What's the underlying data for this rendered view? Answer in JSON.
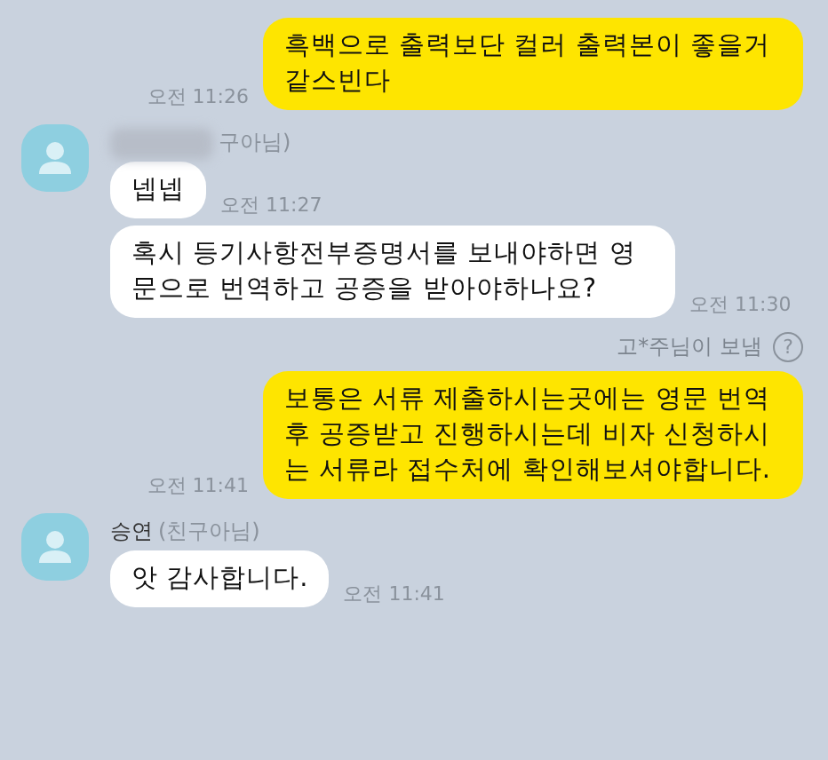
{
  "messages": [
    {
      "kind": "sent",
      "text": "흑백으로 출력보단 컬러 출력본이 좋을거 같스빈다",
      "time": "오전 11:26"
    },
    {
      "kind": "received",
      "sender": {
        "name_redacted": true,
        "note": "구아님)"
      },
      "text": "넵넵",
      "time": "오전 11:27"
    },
    {
      "kind": "received",
      "text": "혹시 등기사항전부증명서를 보내야하면 영문으로 번역하고 공증을 받아야하나요?",
      "time": "오전 11:30"
    },
    {
      "kind": "notice",
      "text": "고*주님이 보냄",
      "help": "?"
    },
    {
      "kind": "sent",
      "text": "보통은 서류 제출하시는곳에는 영문 번역 후 공증받고 진행하시는데 비자 신청하시는 서류라 접수처에 확인해보셔야합니다.",
      "time": "오전 11:41"
    },
    {
      "kind": "received",
      "sender": {
        "name": "승연",
        "note": "(친구아님)"
      },
      "text": "앗 감사합니다.",
      "time": "오전 11:41"
    }
  ]
}
